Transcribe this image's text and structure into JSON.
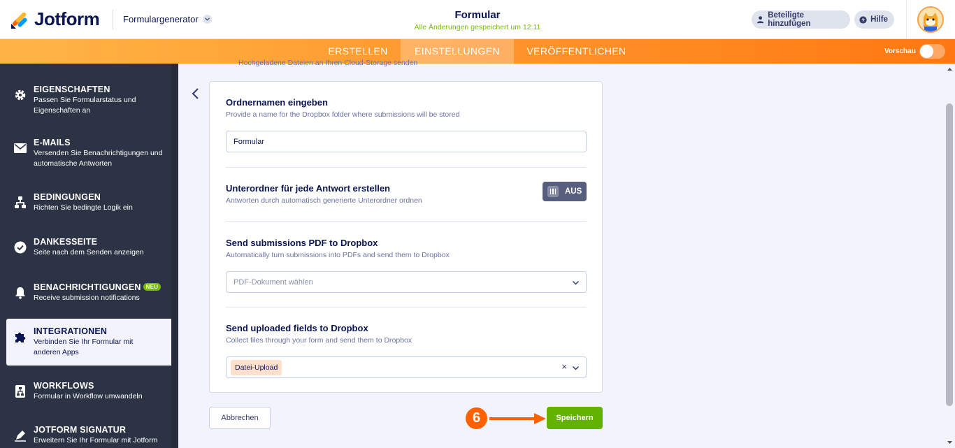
{
  "header": {
    "brand": "Jotform",
    "form_generator_label": "Formulargenerator",
    "title": "Formular",
    "saved_status": "Alle Änderungen gespeichert um 12:11",
    "share_button": "Beteiligte hinzufügen",
    "help_button": "Hilfe"
  },
  "nav": {
    "tabs": [
      {
        "label": "ERSTELLEN",
        "active": false
      },
      {
        "label": "EINSTELLUNGEN",
        "active": true
      },
      {
        "label": "VERÖFFENTLICHEN",
        "active": false
      }
    ],
    "preview_label": "Vorschau",
    "preview_on": false
  },
  "sidebar": {
    "items": [
      {
        "title": "EIGENSCHAFTEN",
        "desc": "Passen Sie Formularstatus und Eigenschaften an",
        "icon": "gear-icon"
      },
      {
        "title": "E-MAILS",
        "desc": "Versenden Sie Benachrichtigungen und automatische Antworten",
        "icon": "envelope-icon"
      },
      {
        "title": "BEDINGUNGEN",
        "desc": "Richten Sie bedingte Logik ein",
        "icon": "logic-tree-icon"
      },
      {
        "title": "DANKESSEITE",
        "desc": "Seite nach dem Senden anzeigen",
        "icon": "check-circle-icon"
      },
      {
        "title": "BENACHRICHTIGUNGEN",
        "badge": "NEU",
        "desc": "Receive submission notifications",
        "icon": "bell-icon"
      },
      {
        "title": "INTEGRATIONEN",
        "desc": "Verbinden Sie Ihr Formular mit anderen Apps",
        "icon": "puzzle-icon",
        "active": true
      },
      {
        "title": "WORKFLOWS",
        "desc": "Formular in Workflow umwandeln",
        "icon": "workflow-icon"
      },
      {
        "title": "JOTFORM SIGNATUR",
        "desc": "Erweitern Sie Ihr Formular mit Jotform",
        "icon": "pen-icon"
      }
    ]
  },
  "main": {
    "clipped_text": "Hochgeladene Dateien an Ihren Cloud-Storage senden",
    "folder_name": {
      "title": "Ordnernamen eingeben",
      "desc": "Provide a name for the Dropbox folder where submissions will be stored",
      "value": "Formular"
    },
    "subfolder": {
      "title": "Unterordner für jede Antwort erstellen",
      "desc": "Antworten durch automatisch generierte Unterordner ordnen",
      "toggle_label": "AUS"
    },
    "pdf": {
      "title": "Send submissions PDF to Dropbox",
      "desc": "Automatically turn submissions into PDFs and send them to Dropbox",
      "placeholder": "PDF-Dokument wählen"
    },
    "uploaded": {
      "title": "Send uploaded fields to Dropbox",
      "desc": "Collect files through your form and send them to Dropbox",
      "selected_tag": "Datei-Upload",
      "clear_symbol": "×"
    },
    "cancel_button": "Abbrechen",
    "save_button": "Speichern",
    "step_number": "6"
  },
  "colors": {
    "accent_orange": "#ff6100",
    "save_green": "#64b200",
    "sidebar_bg": "#2c3345",
    "saved_status_green": "#78bb07"
  }
}
